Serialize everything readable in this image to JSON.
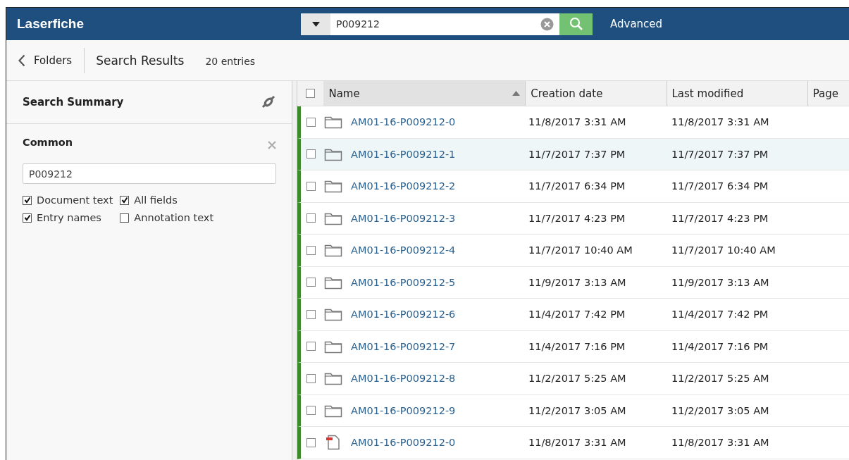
{
  "header": {
    "logo": "Laserfiche",
    "search": {
      "value": "P009212"
    },
    "advanced": "Advanced"
  },
  "toolbar": {
    "back": "Folders",
    "title": "Search Results",
    "count": "20 entries"
  },
  "summary": {
    "title": "Search Summary",
    "section": "Common",
    "field": {
      "value": "P009212"
    },
    "options": [
      {
        "label": "Document text",
        "checked": true
      },
      {
        "label": "All fields",
        "checked": true
      },
      {
        "label": "Entry names",
        "checked": true
      },
      {
        "label": "Annotation text",
        "checked": false
      }
    ]
  },
  "table": {
    "select_all_checked": false,
    "columns": [
      {
        "label": "Name",
        "sorted": true
      },
      {
        "label": "Creation date",
        "sorted": false
      },
      {
        "label": "Last modified",
        "sorted": false
      },
      {
        "label": "Page",
        "sorted": false
      }
    ],
    "rows": [
      {
        "kind": "folder",
        "name": "AM01-16-P009212-0",
        "created": "11/8/2017 3:31 AM",
        "modified": "11/8/2017 3:31 AM",
        "highlighted": false
      },
      {
        "kind": "folder",
        "name": "AM01-16-P009212-1",
        "created": "11/7/2017 7:37 PM",
        "modified": "11/7/2017 7:37 PM",
        "highlighted": true
      },
      {
        "kind": "folder",
        "name": "AM01-16-P009212-2",
        "created": "11/7/2017 6:34 PM",
        "modified": "11/7/2017 6:34 PM",
        "highlighted": false
      },
      {
        "kind": "folder",
        "name": "AM01-16-P009212-3",
        "created": "11/7/2017 4:23 PM",
        "modified": "11/7/2017 4:23 PM",
        "highlighted": false
      },
      {
        "kind": "folder",
        "name": "AM01-16-P009212-4",
        "created": "11/7/2017 10:40 AM",
        "modified": "11/7/2017 10:40 AM",
        "highlighted": false
      },
      {
        "kind": "folder",
        "name": "AM01-16-P009212-5",
        "created": "11/9/2017 3:13 AM",
        "modified": "11/9/2017 3:13 AM",
        "highlighted": false
      },
      {
        "kind": "folder",
        "name": "AM01-16-P009212-6",
        "created": "11/4/2017 7:42 PM",
        "modified": "11/4/2017 7:42 PM",
        "highlighted": false
      },
      {
        "kind": "folder",
        "name": "AM01-16-P009212-7",
        "created": "11/4/2017 7:16 PM",
        "modified": "11/4/2017 7:16 PM",
        "highlighted": false
      },
      {
        "kind": "folder",
        "name": "AM01-16-P009212-8",
        "created": "11/2/2017 5:25 AM",
        "modified": "11/2/2017 5:25 AM",
        "highlighted": false
      },
      {
        "kind": "folder",
        "name": "AM01-16-P009212-9",
        "created": "11/2/2017 3:05 AM",
        "modified": "11/2/2017 3:05 AM",
        "highlighted": false
      },
      {
        "kind": "document",
        "name": "AM01-16-P009212-0",
        "created": "11/8/2017 3:31 AM",
        "modified": "11/8/2017 3:31 AM",
        "highlighted": false
      }
    ]
  }
}
